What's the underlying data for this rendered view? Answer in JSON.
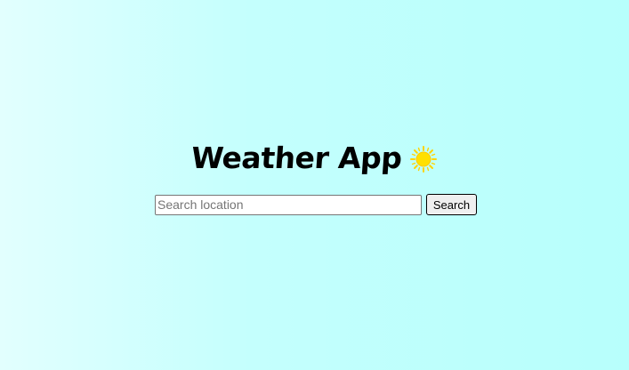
{
  "header": {
    "title": "Weather App",
    "icon": "sun-icon"
  },
  "search": {
    "placeholder": "Search location",
    "value": "",
    "button_label": "Search"
  },
  "colors": {
    "background_left": "#e2fffe",
    "background_right": "#b7fffc",
    "sun": "#ffe000"
  }
}
